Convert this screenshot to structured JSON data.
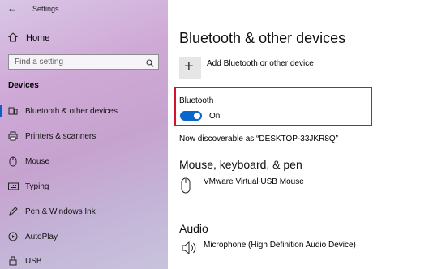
{
  "window": {
    "title": "Settings"
  },
  "sidebar": {
    "home_label": "Home",
    "search_placeholder": "Find a setting",
    "section_title": "Devices",
    "items": [
      {
        "label": "Bluetooth & other devices",
        "icon": "bluetooth-devices-icon",
        "active": true
      },
      {
        "label": "Printers & scanners",
        "icon": "printer-icon"
      },
      {
        "label": "Mouse",
        "icon": "mouse-icon"
      },
      {
        "label": "Typing",
        "icon": "keyboard-icon"
      },
      {
        "label": "Pen & Windows Ink",
        "icon": "pen-icon"
      },
      {
        "label": "AutoPlay",
        "icon": "autoplay-icon"
      },
      {
        "label": "USB",
        "icon": "usb-icon"
      }
    ]
  },
  "main": {
    "title": "Bluetooth & other devices",
    "add_label": "Add Bluetooth or other device",
    "bluetooth": {
      "label": "Bluetooth",
      "state": "On"
    },
    "discoverable": "Now discoverable as “DESKTOP-33JKR8Q”",
    "sections": [
      {
        "title": "Mouse, keyboard, & pen",
        "device": "VMware Virtual USB Mouse",
        "icon": "mouse-device-icon"
      },
      {
        "title": "Audio",
        "device": "Microphone (High Definition Audio Device)",
        "icon": "speaker-icon"
      }
    ]
  },
  "colors": {
    "accent": "#0a66cc",
    "highlight": "#d0142b"
  }
}
